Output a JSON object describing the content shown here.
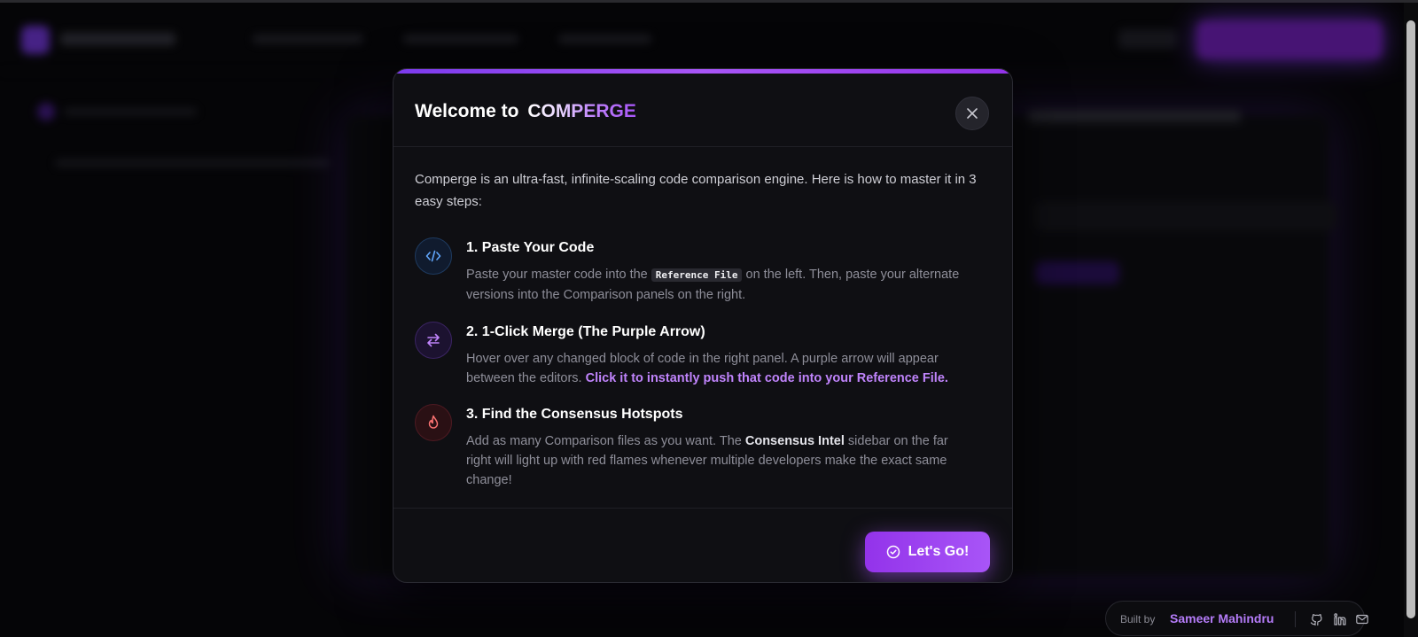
{
  "modal": {
    "title_prefix": "Welcome to",
    "title_brand": "COMPERGE",
    "close_icon": "close-icon",
    "intro": "Comperge is an ultra-fast, infinite-scaling code comparison engine. Here is how to master it in 3 easy steps:",
    "steps": [
      {
        "icon": "code-icon",
        "title": "1. Paste Your Code",
        "desc_before": "Paste your master code into the",
        "desc_code": "Reference File",
        "desc_after": "on the left. Then, paste your alternate versions into the Comparison panels on the right."
      },
      {
        "icon": "swap-arrows-icon",
        "title": "2. 1-Click Merge (The Purple Arrow)",
        "desc_before": "Hover over any changed block of code in the right panel. A purple arrow will appear between the editors.",
        "desc_highlight": "Click it to instantly push that code into your Reference File."
      },
      {
        "icon": "flame-icon",
        "title": "3. Find the Consensus Hotspots",
        "desc_before": "Add as many Comparison files as you want. The",
        "desc_bold": "Consensus Intel",
        "desc_after": "sidebar on the far right will light up with red flames whenever multiple developers make the exact same change!"
      }
    ],
    "cta_label": "Let's Go!",
    "cta_icon": "check-circle-icon"
  },
  "credit": {
    "built_by": "Built by",
    "author": "Sameer Mahindru",
    "icons": [
      "github-icon",
      "linkedin-icon",
      "mail-icon"
    ]
  },
  "colors": {
    "accent": "#a855f7",
    "accent_dark": "#9333ea",
    "background": "#050507",
    "modal_bg": "#0f0f13"
  }
}
